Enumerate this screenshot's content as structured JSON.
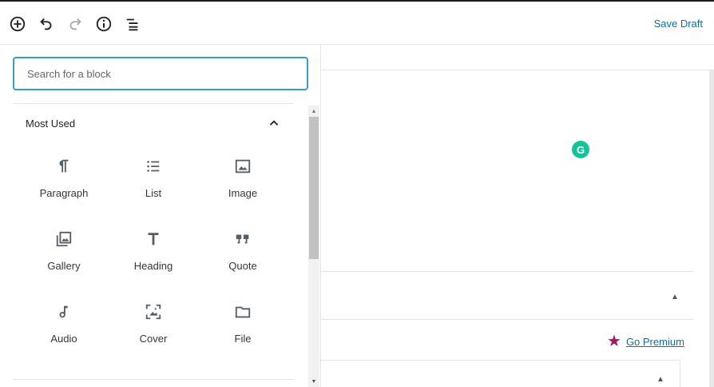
{
  "toolbar": {
    "add_icon": "plus-circle-icon",
    "undo_icon": "undo-icon",
    "redo_icon": "redo-icon",
    "info_icon": "info-icon",
    "outline_icon": "list-outline-icon",
    "save_draft_label": "Save Draft"
  },
  "inserter": {
    "search_placeholder": "Search for a block",
    "section_title": "Most Used",
    "blocks": [
      {
        "label": "Paragraph",
        "icon": "paragraph-icon"
      },
      {
        "label": "List",
        "icon": "list-icon"
      },
      {
        "label": "Image",
        "icon": "image-icon"
      },
      {
        "label": "Gallery",
        "icon": "gallery-icon"
      },
      {
        "label": "Heading",
        "icon": "heading-icon"
      },
      {
        "label": "Quote",
        "icon": "quote-icon"
      },
      {
        "label": "Audio",
        "icon": "audio-icon"
      },
      {
        "label": "Cover",
        "icon": "cover-icon"
      },
      {
        "label": "File",
        "icon": "file-icon"
      }
    ]
  },
  "sidebar": {
    "go_premium_label": "Go Premium"
  },
  "grammarly": {
    "letter": "G",
    "color": "#15c39a"
  },
  "colors": {
    "accent": "#0073aa",
    "search_border": "#33a0c7",
    "premium_star": "#a3195b"
  }
}
